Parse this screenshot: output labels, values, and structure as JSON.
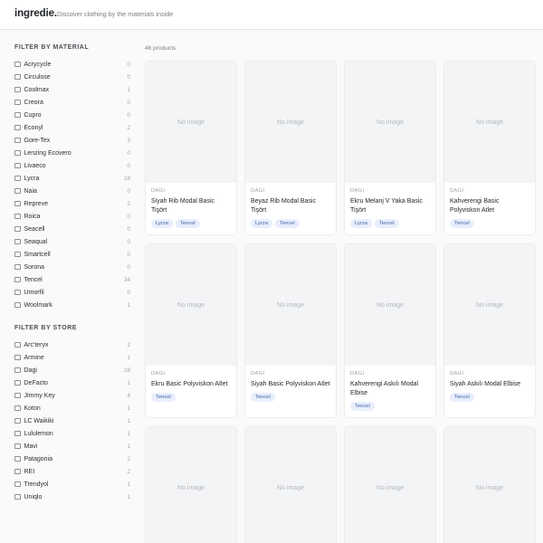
{
  "header": {
    "logo": "ingredie.",
    "tagline": "Discover clothing by the materials inside"
  },
  "filters": {
    "material_title": "FILTER BY MATERIAL",
    "materials": [
      {
        "label": "Acrycycle",
        "count": "0"
      },
      {
        "label": "Circulose",
        "count": "0"
      },
      {
        "label": "Coolmax",
        "count": "1"
      },
      {
        "label": "Creora",
        "count": "0"
      },
      {
        "label": "Cupro",
        "count": "0"
      },
      {
        "label": "Econyl",
        "count": "2"
      },
      {
        "label": "Gore-Tex",
        "count": "3"
      },
      {
        "label": "Lenzing Ecovero",
        "count": "0"
      },
      {
        "label": "Livaeco",
        "count": "0"
      },
      {
        "label": "Lycra",
        "count": "18"
      },
      {
        "label": "Naia",
        "count": "0"
      },
      {
        "label": "Repreve",
        "count": "2"
      },
      {
        "label": "Roica",
        "count": "0"
      },
      {
        "label": "Seacell",
        "count": "0"
      },
      {
        "label": "Seaqual",
        "count": "0"
      },
      {
        "label": "Smartcell",
        "count": "0"
      },
      {
        "label": "Sorona",
        "count": "0"
      },
      {
        "label": "Tencel",
        "count": "34"
      },
      {
        "label": "Umorfil",
        "count": "0"
      },
      {
        "label": "Woolmark",
        "count": "1"
      }
    ],
    "store_title": "FILTER BY STORE",
    "stores": [
      {
        "label": "Arc'teryx",
        "count": "2"
      },
      {
        "label": "Armine",
        "count": "1"
      },
      {
        "label": "Dagi",
        "count": "28"
      },
      {
        "label": "DeFacto",
        "count": "1"
      },
      {
        "label": "Jimmy Key",
        "count": "4"
      },
      {
        "label": "Koton",
        "count": "1"
      },
      {
        "label": "LC Waikiki",
        "count": "1"
      },
      {
        "label": "Lululemon",
        "count": "1"
      },
      {
        "label": "Mavi",
        "count": "1"
      },
      {
        "label": "Patagonia",
        "count": "2"
      },
      {
        "label": "REI",
        "count": "2"
      },
      {
        "label": "Trendyol",
        "count": "1"
      },
      {
        "label": "Uniqlo",
        "count": "1"
      }
    ]
  },
  "results": {
    "count_label": "46 products"
  },
  "products": [
    {
      "image_text": "No image",
      "brand": "DAGI",
      "name": "Siyah Rib Modal Basic Tişört",
      "tags": [
        "Lycra",
        "Tencel"
      ]
    },
    {
      "image_text": "No image",
      "brand": "DAGI",
      "name": "Beyaz Rib Modal Basic Tişört",
      "tags": [
        "Lycra",
        "Tencel"
      ]
    },
    {
      "image_text": "No image",
      "brand": "DAGI",
      "name": "Ekru Melanj V Yaka Basic Tişört",
      "tags": [
        "Lycra",
        "Tencel"
      ]
    },
    {
      "image_text": "No image",
      "brand": "DAGI",
      "name": "Kahverengi Basic Polyviskon Atlet",
      "tags": [
        "Tencel"
      ]
    },
    {
      "image_text": "No image",
      "brand": "DAGI",
      "name": "Ekru Basic Polyviskon Atlet",
      "tags": [
        "Tencel"
      ]
    },
    {
      "image_text": "No image",
      "brand": "DAGI",
      "name": "Siyah Basic Polyviskon Atlet",
      "tags": [
        "Tencel"
      ]
    },
    {
      "image_text": "No image",
      "brand": "DAGI",
      "name": "Kahverengi Askılı Modal Elbise",
      "tags": [
        "Tencel"
      ]
    },
    {
      "image_text": "No image",
      "brand": "DAGI",
      "name": "Siyah Askılı Modal Elbise",
      "tags": [
        "Tencel"
      ]
    },
    {
      "image_text": "No image"
    },
    {
      "image_text": "No image"
    },
    {
      "image_text": "No image"
    },
    {
      "image_text": "No image"
    }
  ]
}
